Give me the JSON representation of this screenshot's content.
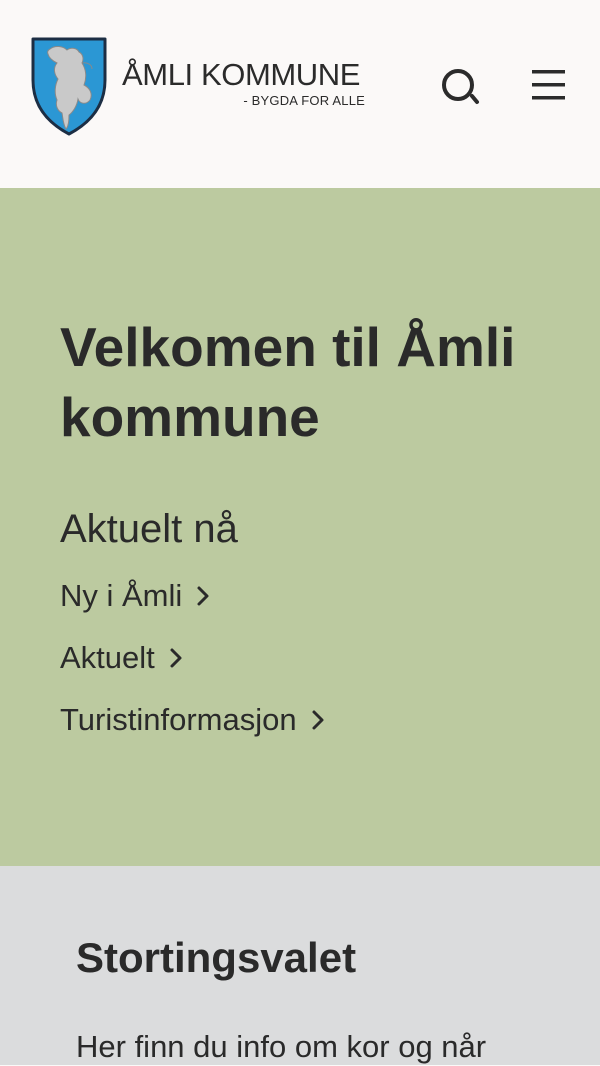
{
  "header": {
    "brand_name": "ÅMLI KOMMUNE",
    "tagline": "- BYGDA FOR ALLE",
    "crest_icon": "beaver-crest-icon",
    "search_icon": "search-icon",
    "menu_icon": "hamburger-menu-icon",
    "crest_colors": {
      "shield": "#2b97d4",
      "beaver": "#c9c9c9",
      "outline": "#1c2e44"
    }
  },
  "hero": {
    "title": "Velkomen til Åmli kommune",
    "subtitle": "Aktuelt nå",
    "links": [
      {
        "label": "Ny i Åmli"
      },
      {
        "label": "Aktuelt"
      },
      {
        "label": "Turistinformasjon"
      }
    ],
    "chevron_icon": "chevron-right-icon",
    "background_color": "#bccaa0"
  },
  "election": {
    "title": "Stortingsvalet",
    "text": "Her finn du info om kor og når",
    "background_color": "#dbdcdd"
  }
}
